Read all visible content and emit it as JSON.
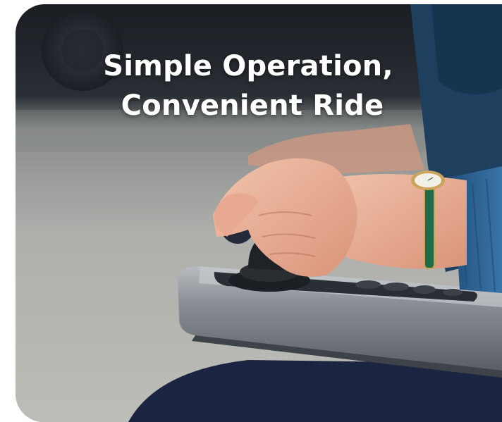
{
  "headline": {
    "line1": "Simple Operation,",
    "line2": "Convenient Ride"
  },
  "scene": {
    "subject": "hand-on-wheelchair-joystick",
    "colors": {
      "background_top": "#1c2026",
      "pavement": "#a9aaa6",
      "controller_body": "#8e9398",
      "sleeve": "#2e5f8c",
      "skin": "#e9b19a",
      "legs": "#1d2640"
    }
  }
}
